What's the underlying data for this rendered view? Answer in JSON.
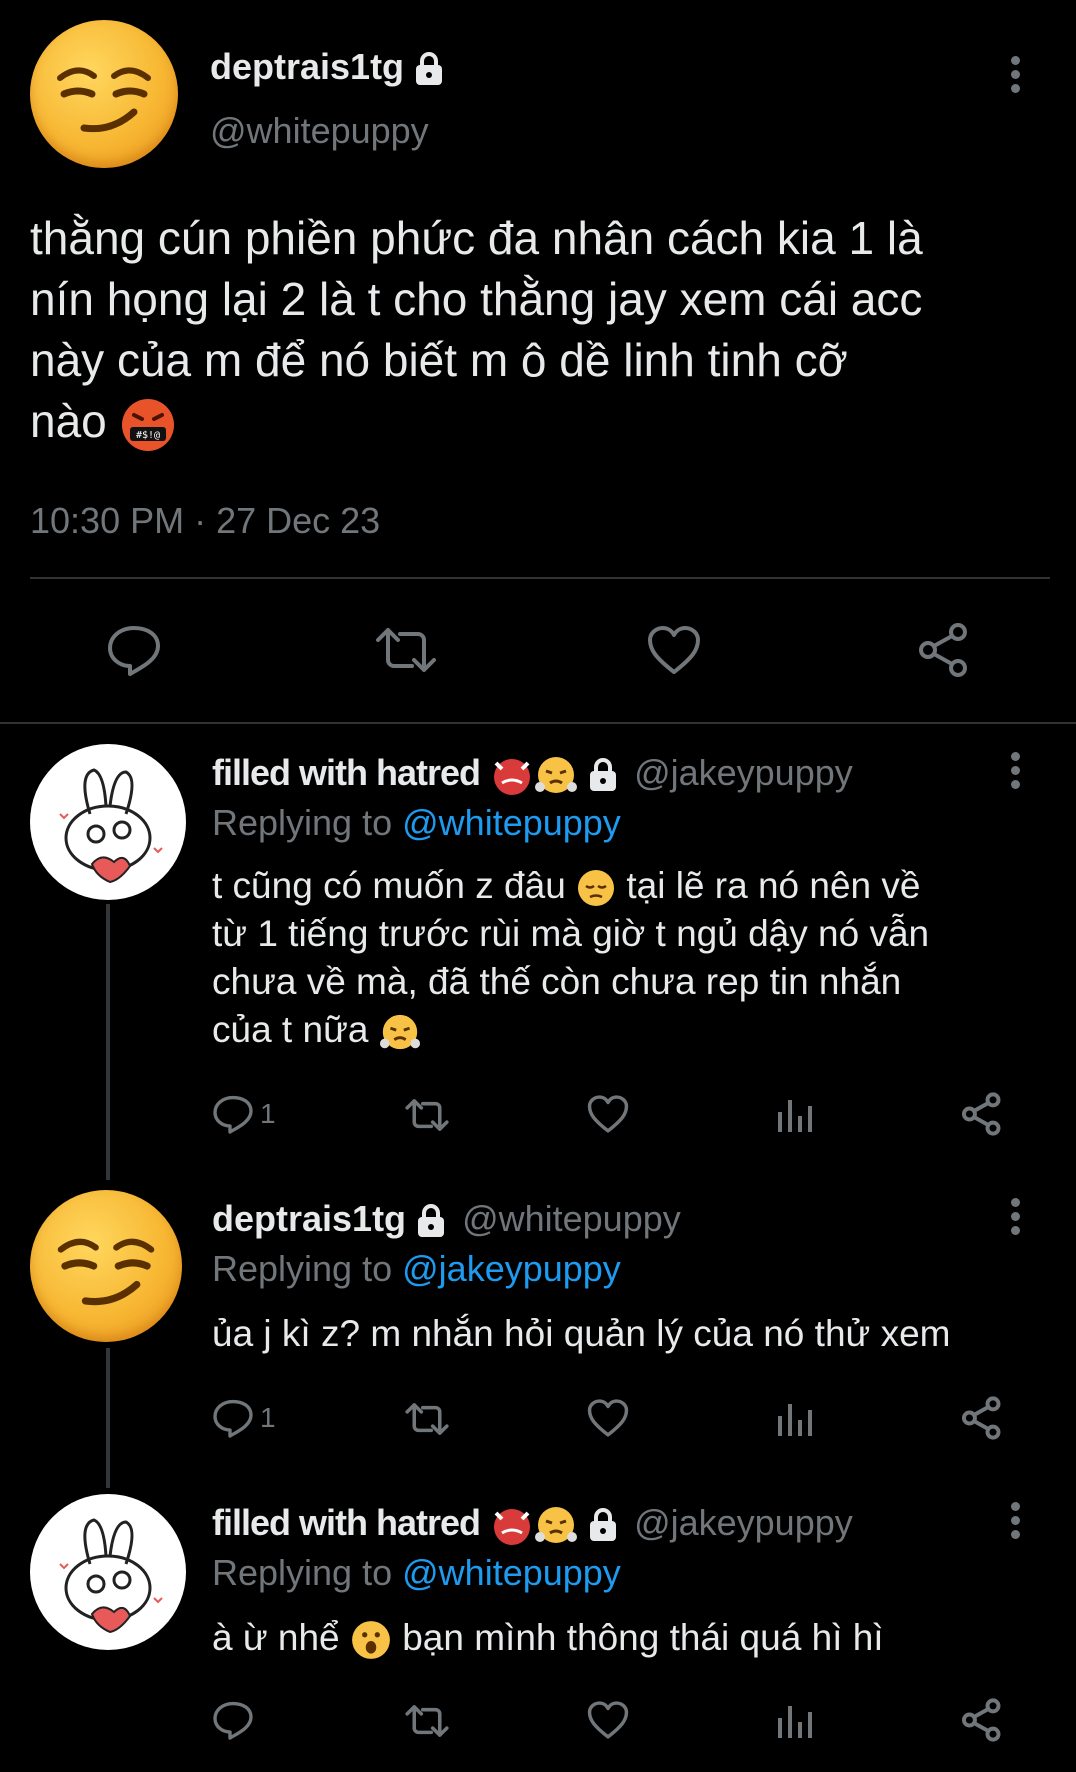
{
  "main_tweet": {
    "display_name": "deptrais1tg",
    "handle": "@whitepuppy",
    "text_lines": [
      "thằng cún phiền phức đa nhân cách kia 1 là",
      "nín họng lại 2 là t cho thằng jay xem cái acc",
      "này của m để nó biết m ô dề linh tinh cỡ",
      "nào"
    ],
    "timestamp": "10:30 PM · 27 Dec 23"
  },
  "replies": [
    {
      "display_name": "filled with hatred",
      "handle": "@jakeypuppy",
      "replying_label": "Replying to",
      "replying_to": "@whitepuppy",
      "text_lines": [
        "t cũng có muốn z đâu",
        "tại lẽ ra nó nên về",
        "từ 1 tiếng trước rùi mà giờ t ngủ dậy nó vẫn",
        "chưa về mà, đã thế còn chưa rep tin nhắn",
        "của t nữa"
      ],
      "reply_count": "1"
    },
    {
      "display_name": "deptrais1tg",
      "handle": "@whitepuppy",
      "replying_label": "Replying to",
      "replying_to": "@jakeypuppy",
      "text_lines": [
        "ủa j kì z? m nhắn hỏi quản lý của nó thử xem"
      ],
      "reply_count": "1"
    },
    {
      "display_name": "filled with hatred",
      "handle": "@jakeypuppy",
      "replying_label": "Replying to",
      "replying_to": "@whitepuppy",
      "text_lines": [
        "à ừ nhể",
        "bạn mình thông thái quá hì hì"
      ],
      "reply_count": ""
    }
  ],
  "icons": {
    "reply": "reply-bubble-icon",
    "retweet": "retweet-icon",
    "like": "heart-icon",
    "views": "views-bar-icon",
    "share": "share-icon",
    "lock": "lock-icon",
    "more": "more-dots-icon"
  },
  "colors": {
    "background": "#000000",
    "text": "#e7e9ea",
    "muted": "#71767b",
    "accent": "#1d9bf0"
  }
}
